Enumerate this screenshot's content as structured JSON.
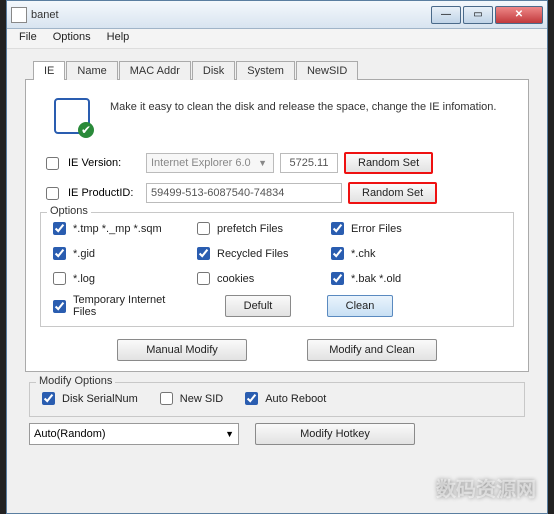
{
  "window": {
    "title": "banet"
  },
  "menu": {
    "file": "File",
    "options": "Options",
    "help": "Help"
  },
  "tabs": {
    "ie": "IE",
    "name": "Name",
    "mac": "MAC Addr",
    "disk": "Disk",
    "system": "System",
    "newsid": "NewSID"
  },
  "intro": "Make it easy to clean the disk and release the space, change the IE infomation.",
  "ie_version": {
    "label": "IE Version:",
    "value": "Internet Explorer 6.0",
    "build": "5725.11",
    "btn": "Random Set"
  },
  "ie_product": {
    "label": "IE ProductID:",
    "value": "59499-513-6087540-74834",
    "btn": "Random Set"
  },
  "options_title": "Options",
  "opts": {
    "tmp": "*.tmp  *._mp  *.sqm",
    "prefetch": "prefetch Files",
    "error": "Error Files",
    "gid": "*.gid",
    "recycled": "Recycled Files",
    "chk": "*.chk",
    "log": "*.log",
    "cookies": "cookies",
    "bak": "*.bak  *.old",
    "tempie": "Temporary Internet Files",
    "default_btn": "Defult",
    "clean_btn": "Clean"
  },
  "btns": {
    "manual": "Manual Modify",
    "modify_clean": "Modify and Clean"
  },
  "mod_opts": {
    "title": "Modify Options",
    "disk": "Disk SerialNum",
    "newsid": "New SID",
    "auto_reboot": "Auto Reboot"
  },
  "bottom": {
    "select": "Auto(Random)",
    "modify_hotkey": "Modify Hotkey"
  },
  "watermark": "数码资源网"
}
